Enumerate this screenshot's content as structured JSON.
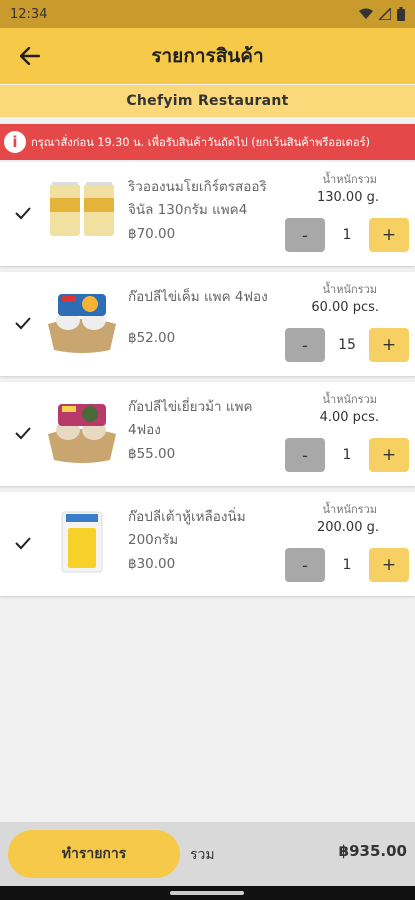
{
  "status": {
    "time": "12:34"
  },
  "appbar": {
    "title": "รายการสินค้า"
  },
  "restaurant": {
    "name": "Chefyim Restaurant"
  },
  "notice": {
    "text": "กรุณาสั่งก่อน 19.30 น. เพื่อรับสินค้าวันถัดไป (ยกเว้นสินค้าพรีออเดอร์)"
  },
  "weight_label": "น้ำหนักรวม",
  "items": [
    {
      "name": "ริวอองนมโยเกิร์ตรสออริจินัล 130กรัม แพค4",
      "price": "฿70.00",
      "weight": "130.00 g.",
      "qty": "1",
      "checked": true
    },
    {
      "name": "ก๊อปลีไข่เค็ม แพค 4ฟอง",
      "price": "฿52.00",
      "weight": "60.00 pcs.",
      "qty": "15",
      "checked": true
    },
    {
      "name": "ก๊อปลีไข่เยี่ยวม้า แพค 4ฟอง",
      "price": "฿55.00",
      "weight": "4.00 pcs.",
      "qty": "1",
      "checked": true
    },
    {
      "name": "ก๊อปลีเต้าหู้เหลืองนิ่ม 200กรัม",
      "price": "฿30.00",
      "weight": "200.00 g.",
      "qty": "1",
      "checked": true
    }
  ],
  "qty_controls": {
    "minus": "-",
    "plus": "+"
  },
  "footer": {
    "checkout_label": "ทำรายการ",
    "total_label": "รวม",
    "total_value": "฿935.00"
  },
  "colors": {
    "primary": "#f7c948",
    "status_bar": "#c89b2c",
    "notice_bg": "#e54848",
    "minus_btn": "#a8a8a8",
    "plus_btn": "#f7d064"
  },
  "icons": {
    "back": "arrow-left-icon",
    "info": "info-icon",
    "check": "check-icon",
    "wifi": "wifi-icon",
    "signal": "signal-icon",
    "battery": "battery-icon"
  }
}
